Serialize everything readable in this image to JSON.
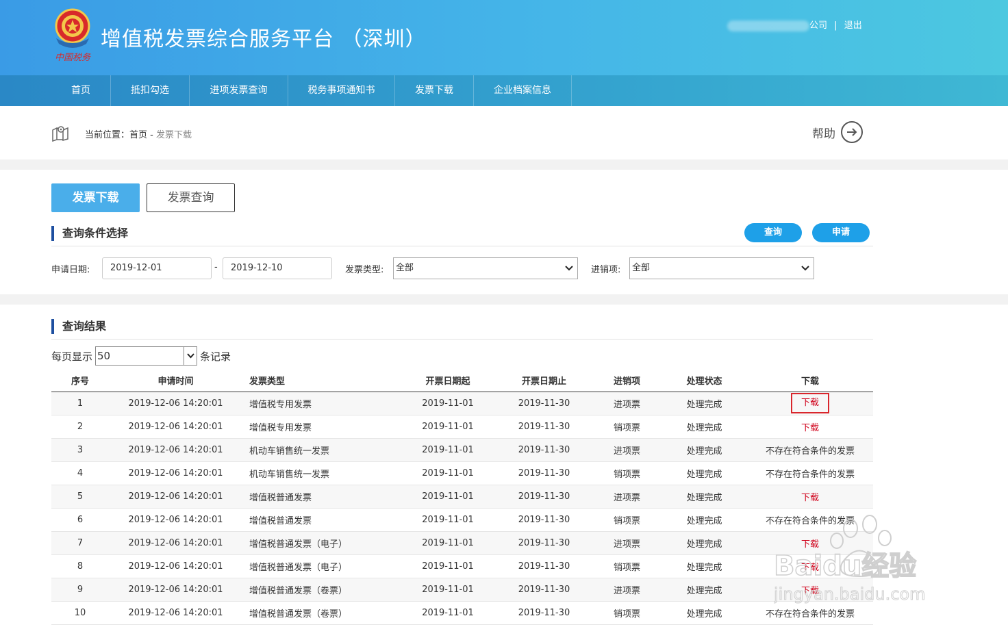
{
  "header": {
    "title": "增值税发票综合服务平台 （深圳）",
    "logo_text": "中国税务",
    "user_suffix": "公司",
    "separator": "|",
    "logout_label": "退出"
  },
  "nav": {
    "items": [
      {
        "label": "首页"
      },
      {
        "label": "抵扣勾选"
      },
      {
        "label": "进项发票查询"
      },
      {
        "label": "税务事项通知书"
      },
      {
        "label": "发票下载"
      },
      {
        "label": "企业档案信息"
      }
    ]
  },
  "breadcrumb": {
    "prefix": "当前位置：",
    "home": "首页",
    "separator": "-",
    "current": "发票下载"
  },
  "help": {
    "label": "帮助"
  },
  "tabs": {
    "download_label": "发票下载",
    "query_label": "发票查询"
  },
  "query": {
    "title": "查询条件选择",
    "search_button": "查询",
    "apply_button": "申请",
    "date_label": "申请日期:",
    "date_from": "2019-12-01",
    "date_separator": "-",
    "date_to": "2019-12-10",
    "type_label": "发票类型:",
    "type_value": "全部",
    "direction_label": "进销项:",
    "direction_value": "全部"
  },
  "results": {
    "title": "查询结果",
    "per_page_prefix": "每页显示",
    "per_page_value": "50",
    "per_page_suffix": "条记录",
    "columns": [
      "序号",
      "申请时间",
      "发票类型",
      "开票日期起",
      "开票日期止",
      "进销项",
      "处理状态",
      "下载"
    ],
    "rows": [
      {
        "no": "1",
        "time": "2019-12-06 14:20:01",
        "type": "增值税专用发票",
        "start": "2019-11-01",
        "end": "2019-11-30",
        "direction": "进项票",
        "status": "处理完成",
        "download": "下载",
        "has_file": true,
        "highlighted": true
      },
      {
        "no": "2",
        "time": "2019-12-06 14:20:01",
        "type": "增值税专用发票",
        "start": "2019-11-01",
        "end": "2019-11-30",
        "direction": "销项票",
        "status": "处理完成",
        "download": "下载",
        "has_file": true,
        "highlighted": false
      },
      {
        "no": "3",
        "time": "2019-12-06 14:20:01",
        "type": "机动车销售统一发票",
        "start": "2019-11-01",
        "end": "2019-11-30",
        "direction": "进项票",
        "status": "处理完成",
        "download": "不存在符合条件的发票",
        "has_file": false,
        "highlighted": false
      },
      {
        "no": "4",
        "time": "2019-12-06 14:20:01",
        "type": "机动车销售统一发票",
        "start": "2019-11-01",
        "end": "2019-11-30",
        "direction": "销项票",
        "status": "处理完成",
        "download": "不存在符合条件的发票",
        "has_file": false,
        "highlighted": false
      },
      {
        "no": "5",
        "time": "2019-12-06 14:20:01",
        "type": "增值税普通发票",
        "start": "2019-11-01",
        "end": "2019-11-30",
        "direction": "进项票",
        "status": "处理完成",
        "download": "下载",
        "has_file": true,
        "highlighted": false
      },
      {
        "no": "6",
        "time": "2019-12-06 14:20:01",
        "type": "增值税普通发票",
        "start": "2019-11-01",
        "end": "2019-11-30",
        "direction": "销项票",
        "status": "处理完成",
        "download": "不存在符合条件的发票",
        "has_file": false,
        "highlighted": false
      },
      {
        "no": "7",
        "time": "2019-12-06 14:20:01",
        "type": "增值税普通发票（电子）",
        "start": "2019-11-01",
        "end": "2019-11-30",
        "direction": "进项票",
        "status": "处理完成",
        "download": "下载",
        "has_file": true,
        "highlighted": false
      },
      {
        "no": "8",
        "time": "2019-12-06 14:20:01",
        "type": "增值税普通发票（电子）",
        "start": "2019-11-01",
        "end": "2019-11-30",
        "direction": "销项票",
        "status": "处理完成",
        "download": "下载",
        "has_file": true,
        "highlighted": false
      },
      {
        "no": "9",
        "time": "2019-12-06 14:20:01",
        "type": "增值税普通发票（卷票）",
        "start": "2019-11-01",
        "end": "2019-11-30",
        "direction": "进项票",
        "status": "处理完成",
        "download": "下载",
        "has_file": true,
        "highlighted": false
      },
      {
        "no": "10",
        "time": "2019-12-06 14:20:01",
        "type": "增值税普通发票（卷票）",
        "start": "2019-11-01",
        "end": "2019-11-30",
        "direction": "销项票",
        "status": "处理完成",
        "download": "不存在符合条件的发票",
        "has_file": false,
        "highlighted": false
      }
    ]
  },
  "watermark": {
    "brand": "Baidu经验",
    "url": "jingyan.baidu.com"
  },
  "colors": {
    "header_start": "#3a9be6",
    "header_end": "#4cc8e0",
    "accent": "#1ea0e8",
    "download_link": "#d0021b",
    "section_bar": "#1e4fa0"
  }
}
